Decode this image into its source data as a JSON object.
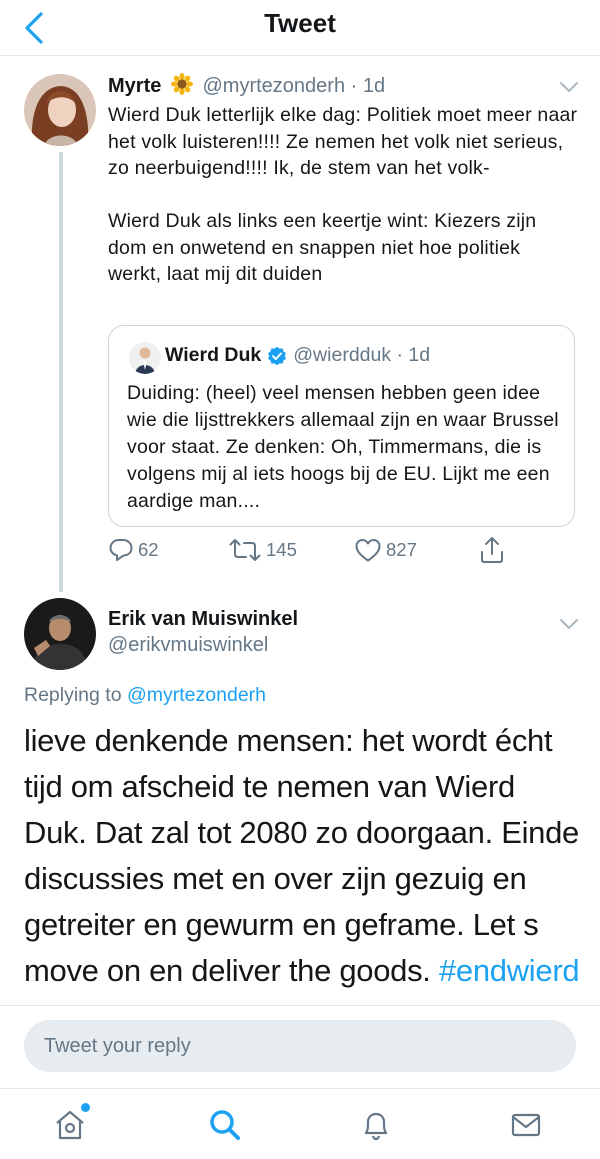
{
  "header": {
    "title": "Tweet"
  },
  "tweet1": {
    "name": "Myrte",
    "name_emoji": "sunflower-emoji",
    "handle_time": "@myrtezonderh · 1d",
    "text": "Wierd Duk letterlijk elke dag: Politiek moet meer naar het volk luisteren!!!! Ze nemen het volk niet serieus, zo neerbuigend!!!! Ik, de stem van het volk-\n\nWierd Duk als links een keertje wint: Kiezers zijn dom en onwetend en snappen niet hoe politiek werkt, laat mij dit duiden",
    "quote": {
      "name": "Wierd Duk",
      "handle_time": "@wierdduk · 1d",
      "text": "Duiding: (heel) veel mensen hebben geen idee wie die lijsttrekkers allemaal zijn en waar Brussel voor staat. Ze denken: Oh, Timmermans, die is volgens mij al iets hoogs bij de EU. Lijkt me een aardige man...."
    },
    "actions": {
      "replies": "62",
      "retweets": "145",
      "likes": "827"
    }
  },
  "tweet2": {
    "name": "Erik van Muiswinkel",
    "handle": "@erikvmuiswinkel",
    "replying_prefix": "Replying to ",
    "replying_handle": "@myrtezonderh",
    "text": "lieve denkende mensen: het wordt écht tijd om afscheid te nemen van Wierd Duk. Dat zal tot 2080 zo doorgaan. Einde discussies met en over zijn gezuig en getreiter en gewurm en geframe. Let s move on en deliver the goods. ",
    "hashtag": "#endwierd"
  },
  "reply": {
    "placeholder": "Tweet your reply"
  },
  "colors": {
    "accent": "#1da1f2",
    "muted": "#657786",
    "border": "#e1e8ed"
  },
  "tabs": [
    "home-icon",
    "search-icon",
    "notifications-icon",
    "messages-icon"
  ]
}
